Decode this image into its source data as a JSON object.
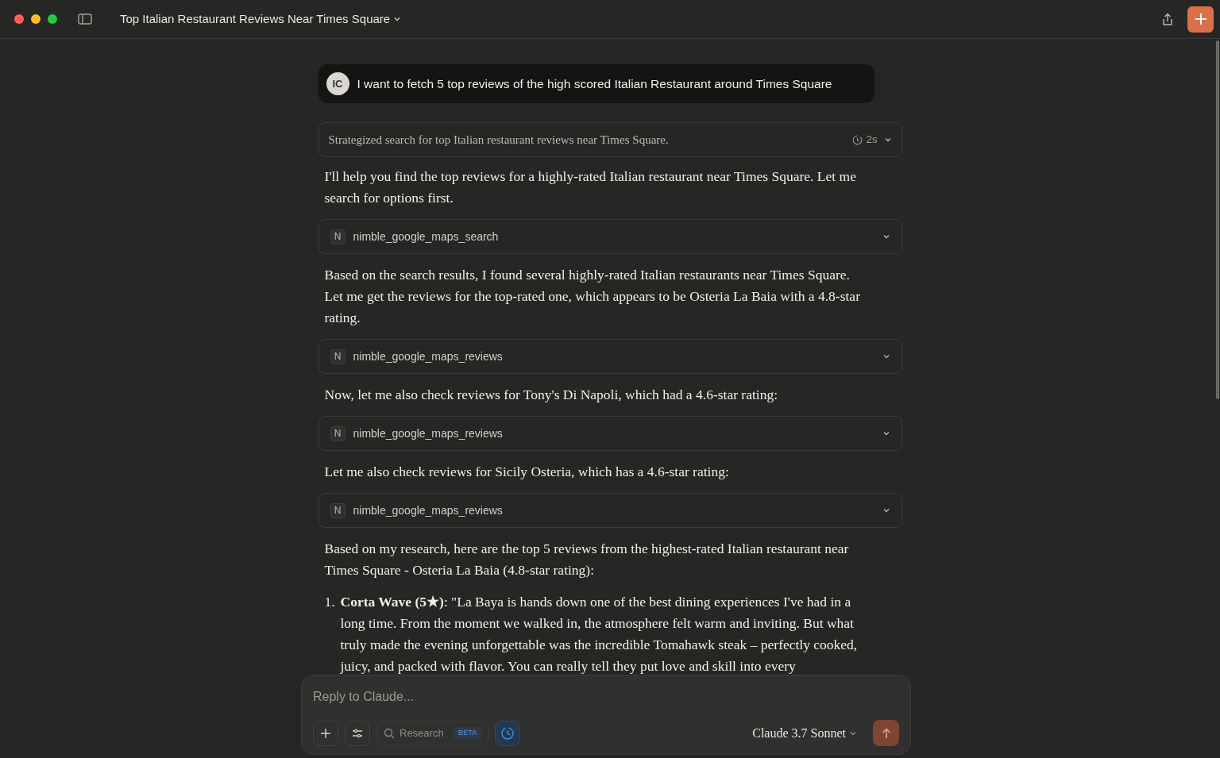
{
  "window": {
    "title": "Top Italian Restaurant Reviews Near Times Square"
  },
  "messages": [
    {
      "kind": "user",
      "avatar": "IC",
      "text": "I want to fetch 5 top reviews of the high scored Italian Restaurant around Times Square"
    },
    {
      "kind": "thinking",
      "text": "Strategized search for top Italian restaurant reviews near Times Square.",
      "duration": "2s"
    },
    {
      "kind": "text",
      "text": "I'll help you find the top reviews for a highly-rated Italian restaurant near Times Square. Let me search for options first."
    },
    {
      "kind": "tool",
      "badge": "N",
      "name": "nimble_google_maps_search"
    },
    {
      "kind": "text",
      "text": "Based on the search results, I found several highly-rated Italian restaurants near Times Square. Let me get the reviews for the top-rated one, which appears to be Osteria La Baia with a 4.8-star rating."
    },
    {
      "kind": "tool",
      "badge": "N",
      "name": "nimble_google_maps_reviews"
    },
    {
      "kind": "text",
      "text": "Now, let me also check reviews for Tony's Di Napoli, which had a 4.6-star rating:"
    },
    {
      "kind": "tool",
      "badge": "N",
      "name": "nimble_google_maps_reviews"
    },
    {
      "kind": "text",
      "text": "Let me also check reviews for Sicily Osteria, which has a 4.6-star rating:"
    },
    {
      "kind": "tool",
      "badge": "N",
      "name": "nimble_google_maps_reviews"
    },
    {
      "kind": "text",
      "text": "Based on my research, here are the top 5 reviews from the highest-rated Italian restaurant near Times Square - Osteria La Baia (4.8-star rating):"
    },
    {
      "kind": "list",
      "items": [
        {
          "number": "1.",
          "text": "**Corta Wave (5★)**: \"La Baya is hands down one of the best dining experiences I've had in a long time. From the moment we walked in, the atmosphere felt warm and inviting. But what truly made the evening unforgettable was the incredible Tomahawk steak – perfectly cooked, juicy, and packed with flavor. You can really tell they put love and skill into every"
        }
      ]
    }
  ],
  "composer": {
    "placeholder": "Reply to Claude...",
    "research": {
      "label": "Research",
      "badge": "BETA"
    },
    "extended_thinking": {
      "on": true
    },
    "model": "Claude 3.7 Sonnet"
  }
}
